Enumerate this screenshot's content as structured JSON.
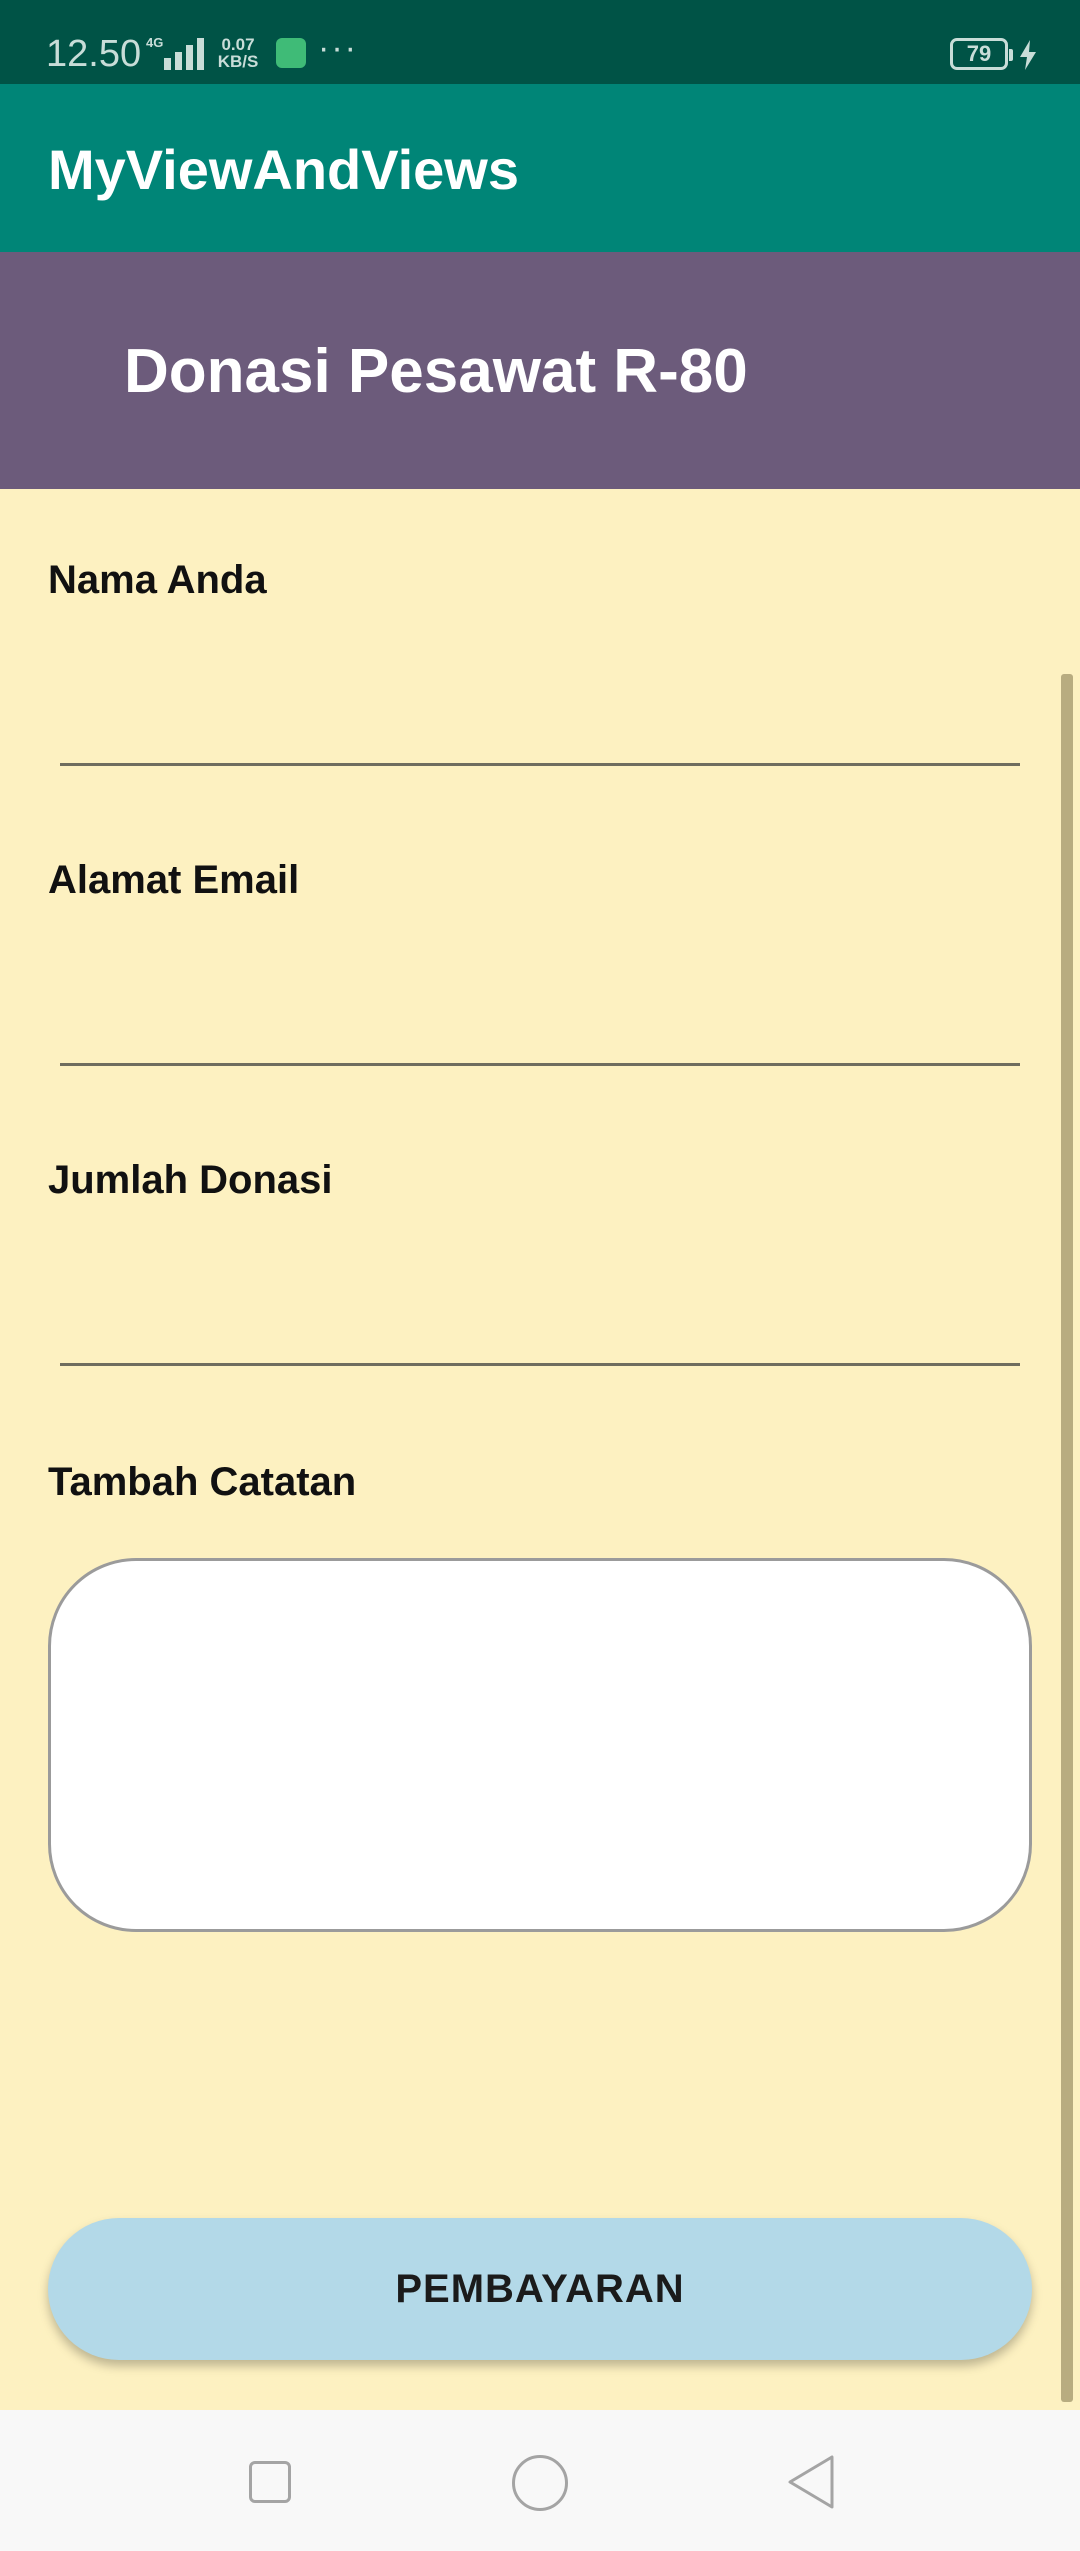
{
  "status_bar": {
    "time": "12.50",
    "network": "4G",
    "speed_value": "0.07",
    "speed_unit": "KB/S",
    "more": "···",
    "battery": "79"
  },
  "app_bar": {
    "title": "MyViewAndViews"
  },
  "banner": {
    "title": "Donasi Pesawat R-80"
  },
  "form": {
    "name_label": "Nama Anda",
    "name_value": "",
    "email_label": "Alamat Email",
    "email_value": "",
    "amount_label": "Jumlah Donasi",
    "amount_value": "",
    "notes_label": "Tambah Catatan",
    "notes_value": ""
  },
  "actions": {
    "pay_label": "PEMBAYARAN"
  },
  "colors": {
    "status_bar": "#005346",
    "app_bar": "#008577",
    "banner": "#6c5b7b",
    "background": "#fdf1c1",
    "button": "#b3d9e8"
  },
  "nav": {
    "icons": [
      "square-recent-icon",
      "circle-home-icon",
      "triangle-back-icon"
    ]
  }
}
